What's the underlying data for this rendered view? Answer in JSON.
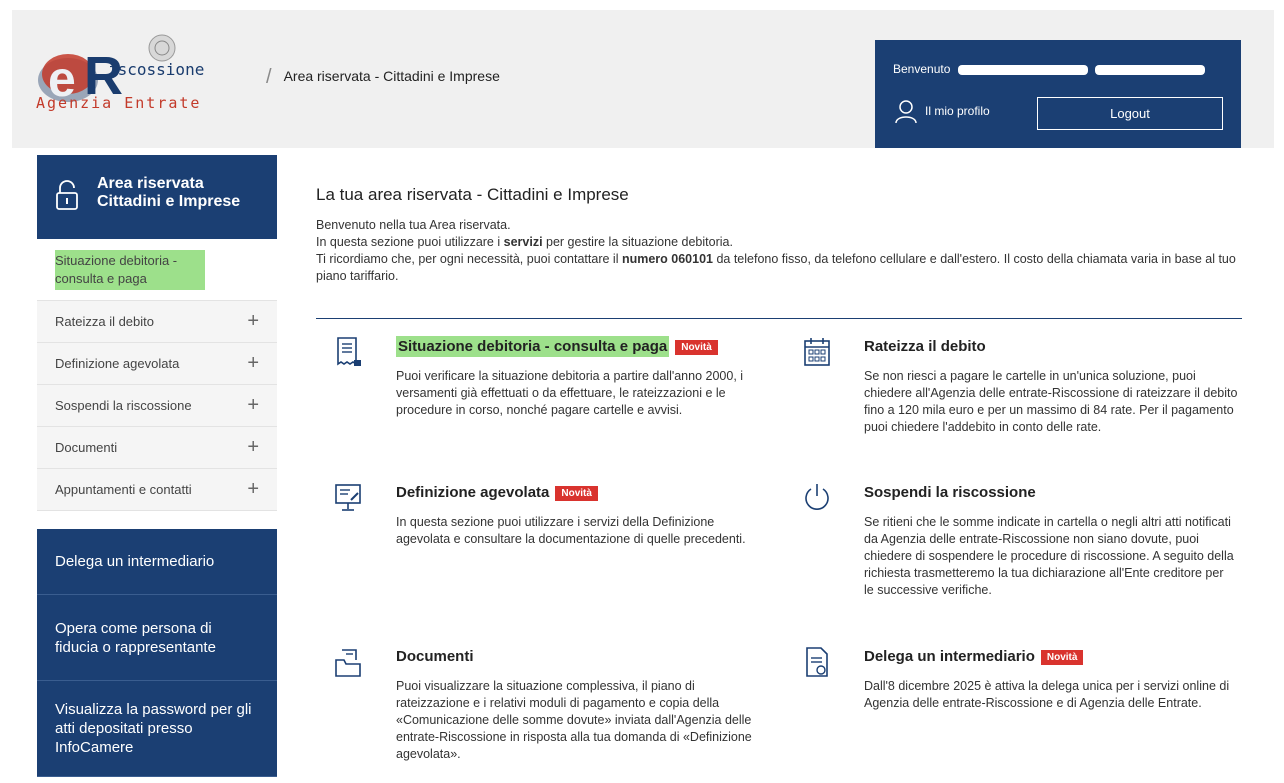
{
  "header": {
    "logo_line1": "iscossione",
    "logo_line2": "Agenzia Entrate",
    "breadcrumb": "Area riservata - Cittadini e Imprese",
    "welcome": "Benvenuto",
    "profile": "Il mio profilo",
    "logout": "Logout"
  },
  "sidebar": {
    "title_line1": "Area riservata",
    "title_line2": "Cittadini e Imprese",
    "items": [
      {
        "label": "Situazione debitoria - consulta e paga"
      },
      {
        "label": "Rateizza il debito"
      },
      {
        "label": "Definizione agevolata"
      },
      {
        "label": "Sospendi la riscossione"
      },
      {
        "label": "Documenti"
      },
      {
        "label": "Appuntamenti e contatti"
      }
    ],
    "dark": [
      {
        "label": "Delega un intermediario"
      },
      {
        "label": "Opera come persona di fiducia o rappresentante"
      },
      {
        "label": "Visualizza la password per gli atti depositati presso InfoCamere"
      }
    ]
  },
  "main": {
    "title": "La tua area riservata - Cittadini e Imprese",
    "intro1": "Benvenuto nella tua Area riservata.",
    "intro2a": "In questa sezione puoi utilizzare i ",
    "intro2b": "servizi",
    "intro2c": " per gestire la situazione debitoria.",
    "intro3a": "Ti ricordiamo che, per ogni necessità, puoi contattare il ",
    "intro3b": "numero 060101",
    "intro3c": " da telefono fisso, da telefono cellulare e dall'estero. Il costo della chiamata varia in base al tuo piano tariffario.",
    "badge": "Novità",
    "cards": [
      {
        "title": "Situazione debitoria - consulta e paga",
        "desc": "Puoi verificare la situazione debitoria a partire dall'anno 2000, i versamenti già effettuati o da effettuare, le rateizzazioni e le procedure in corso, nonché pagare cartelle e avvisi."
      },
      {
        "title": "Rateizza il debito",
        "desc": "Se non riesci a pagare le cartelle in un'unica soluzione, puoi chiedere all'Agenzia delle entrate-Riscossione di rateizzare il debito fino a 120 mila euro e per un massimo di 84 rate. Per il pagamento puoi chiedere l'addebito in conto delle rate."
      },
      {
        "title": "Definizione agevolata",
        "desc": "In questa sezione puoi utilizzare i servizi della Definizione agevolata e consultare la documentazione di quelle precedenti."
      },
      {
        "title": "Sospendi la riscossione",
        "desc": "Se ritieni che le somme indicate in cartella o negli altri atti notificati da Agenzia delle entrate-Riscossione non siano dovute, puoi chiedere di sospendere le procedure di riscossione. A seguito della richiesta trasmetteremo la tua dichiarazione all'Ente creditore per le successive verifiche."
      },
      {
        "title": "Documenti",
        "desc": "Puoi visualizzare la situazione complessiva, il piano di rateizzazione e i relativi moduli di pagamento e copia della «Comunicazione delle somme dovute» inviata dall'Agenzia delle entrate-Riscossione in risposta alla tua domanda di «Definizione agevolata»."
      },
      {
        "title": "Delega un intermediario",
        "desc": "Dall'8 dicembre 2025 è attiva la delega unica per i servizi online di Agenzia delle entrate-Riscossione e di Agenzia delle Entrate."
      }
    ]
  },
  "colors": {
    "brand": "#1b3f73",
    "badge": "#d9332e",
    "highlight": "#9de08b"
  }
}
